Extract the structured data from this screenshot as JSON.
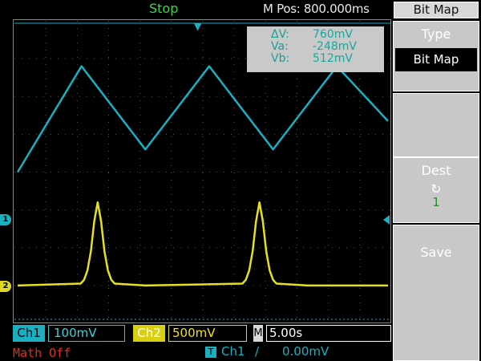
{
  "status": "Stop",
  "mpos": "M Pos: 800.000ms",
  "menu": {
    "title": "Bit Map",
    "type_label": "Type",
    "type_value": "Bit Map",
    "dest_label": "Dest",
    "dest_icon": "refresh-icon",
    "dest_value": "1",
    "save_label": "Save"
  },
  "cursor": {
    "dv_label": "ΔV:",
    "dv_value": "760mV",
    "va_label": "Va:",
    "va_value": "-248mV",
    "vb_label": "Vb:",
    "vb_value": "512mV"
  },
  "channels": {
    "ch1_label": "Ch1",
    "ch1_scale": "100mV",
    "ch2_label": "Ch2",
    "ch2_scale": "500mV",
    "m_label": "M",
    "timebase": "5.00s"
  },
  "math": "Math Off",
  "trigger": {
    "tag": "T",
    "source": "Ch1",
    "edge": "/",
    "level": "0.00mV"
  },
  "markers": {
    "ch1": "1",
    "ch2": "2"
  },
  "colors": {
    "ch1": "#1ab0c2",
    "ch2": "#e6e020",
    "grid": "#5a5a5a",
    "status": "#3fd24a"
  },
  "chart_data": {
    "type": "line",
    "title": "",
    "xlabel": "",
    "ylabel": "",
    "series": [
      {
        "x": [
          0,
          7.5,
          15,
          22.5,
          30,
          37.5,
          43.5
        ],
        "y": [
          0,
          2.8,
          0.6,
          2.8,
          0.6,
          2.8,
          1.35
        ]
      },
      {
        "x": [
          0,
          7.4,
          7.8,
          8.2,
          8.6,
          9.0,
          9.4,
          9.8,
          10.2,
          10.6,
          11.0,
          11.4,
          15,
          26.4,
          26.8,
          27.2,
          27.6,
          28.0,
          28.4,
          28.8,
          29.2,
          29.6,
          30.0,
          30.4,
          34,
          43.5
        ],
        "y": [
          -3.0,
          -2.95,
          -2.85,
          -2.6,
          -2.1,
          -1.3,
          -0.8,
          -1.3,
          -2.1,
          -2.6,
          -2.85,
          -2.95,
          -3.0,
          -2.95,
          -2.85,
          -2.6,
          -2.1,
          -1.3,
          -0.8,
          -1.3,
          -2.1,
          -2.6,
          -2.85,
          -2.95,
          -3.0,
          -3.0
        ]
      }
    ],
    "xlim": [
      0,
      43.5
    ],
    "ylim": [
      -4,
      4
    ],
    "grid": true
  }
}
